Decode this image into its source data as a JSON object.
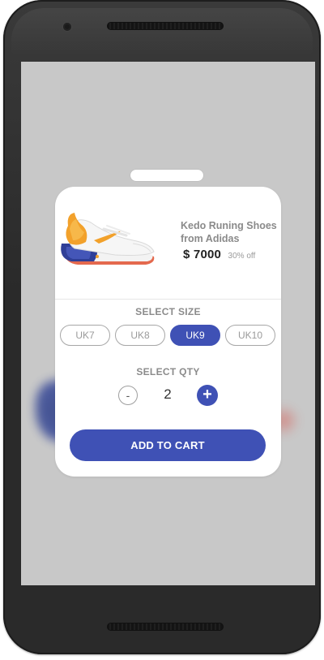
{
  "product": {
    "title": "Kedo Runing Shoes from Adidas",
    "price": "$ 7000",
    "discount": "30% off"
  },
  "size_section": {
    "label": "SELECT SIZE",
    "options": [
      "UK7",
      "UK8",
      "UK9",
      "UK10"
    ],
    "selected": "UK9"
  },
  "qty_section": {
    "label": "SELECT QTY",
    "minus_label": "-",
    "plus_label": "+",
    "value": "2"
  },
  "cta": {
    "label": "ADD TO CART"
  },
  "colors": {
    "accent": "#3f51b5",
    "screen_bg": "#c8c8c8",
    "card_bg": "#ffffff",
    "phone_frame": "#2a2a2a"
  },
  "icons": [
    "sneaker-image",
    "plus-icon",
    "minus-icon"
  ]
}
